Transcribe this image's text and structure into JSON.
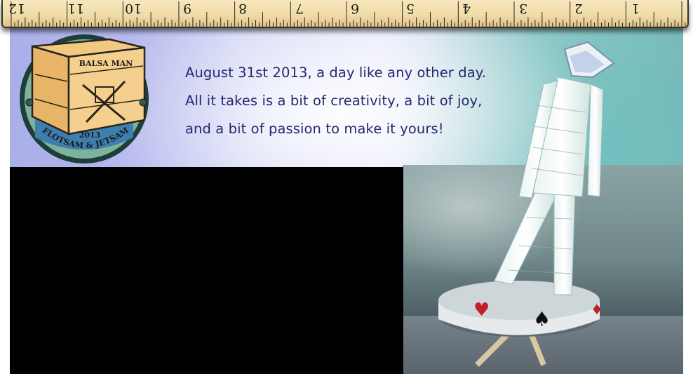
{
  "ruler": {
    "numbers": [
      "12",
      "11",
      "10",
      "9",
      "8",
      "7",
      "6",
      "5",
      "4",
      "3",
      "2",
      "1"
    ]
  },
  "logo": {
    "top_text": "BALSA MAN",
    "year": "2013",
    "bottom_text": "FLOTSAM & JETSAM"
  },
  "tagline": {
    "line1": "August 31st 2013, a day like any other day.",
    "line2": "All it takes is a bit of creativity, a bit of joy,",
    "line3": "and a bit of passion to make it yours!"
  },
  "colors": {
    "tagline_text": "#25286e",
    "ruler_wood": "#f1dcaa",
    "video_bg": "#000000"
  }
}
